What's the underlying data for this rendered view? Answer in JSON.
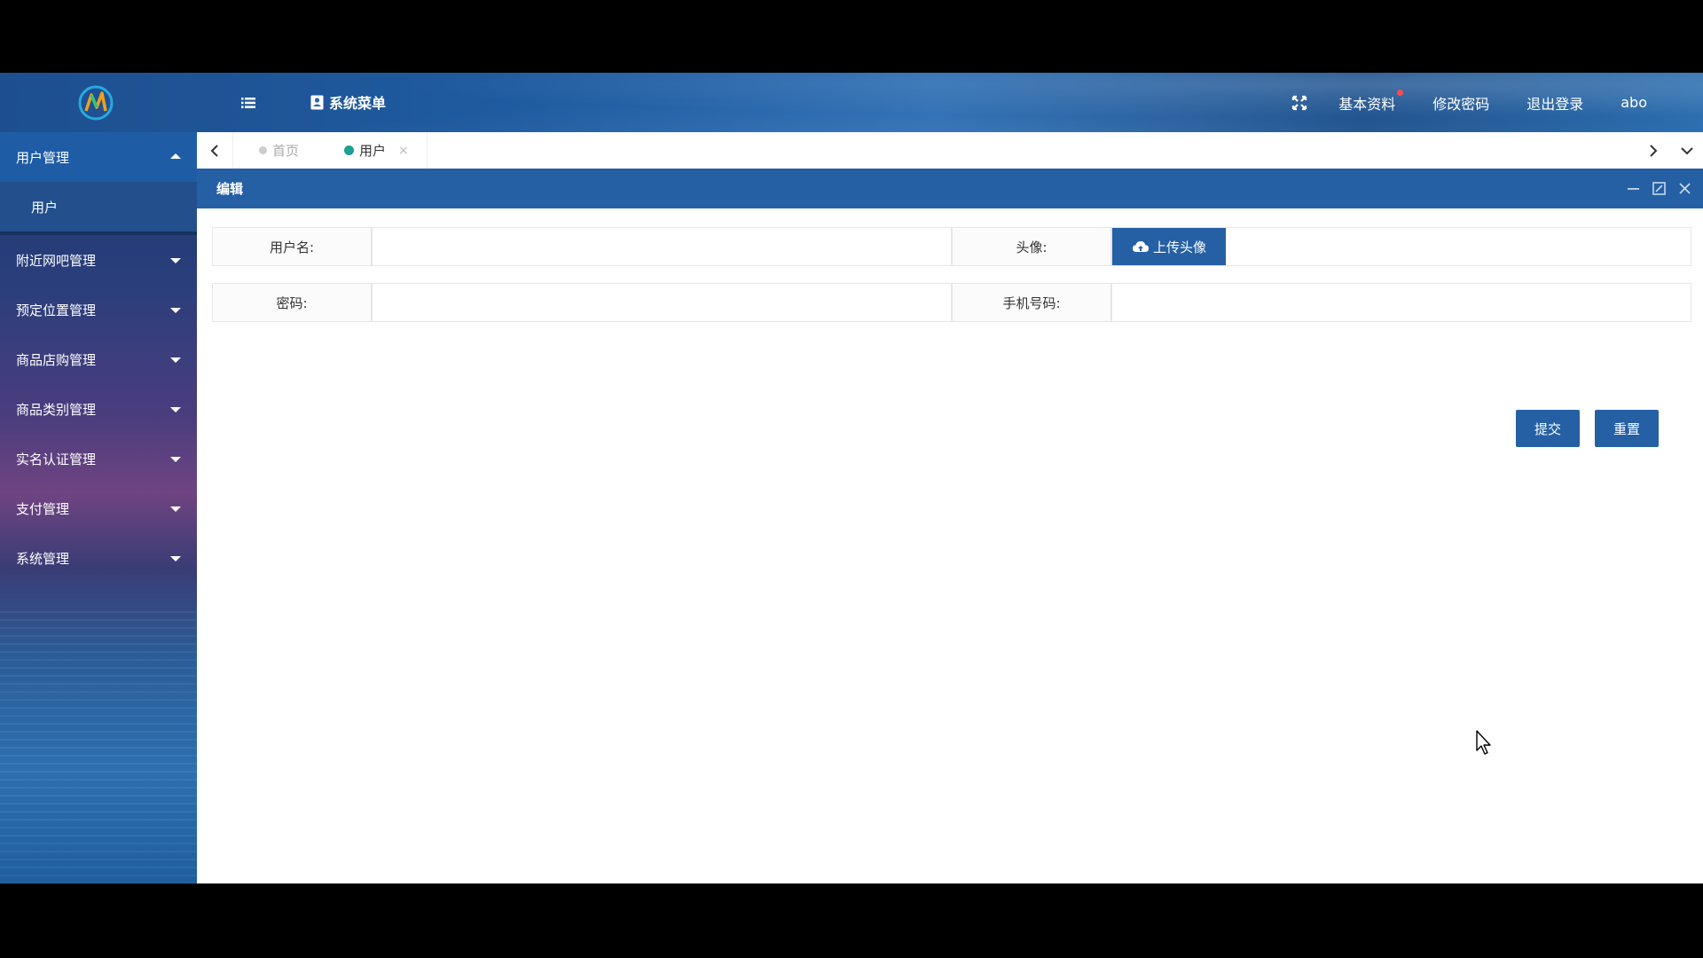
{
  "header": {
    "sys_menu_label": "系统菜单",
    "links": {
      "profile": "基本资料",
      "change_password": "修改密码",
      "logout": "退出登录"
    },
    "username": "abo"
  },
  "sidebar": {
    "active_group": "用户管理",
    "active_sub": "用户",
    "items": [
      "附近网吧管理",
      "预定位置管理",
      "商品店购管理",
      "商品类别管理",
      "实名认证管理",
      "支付管理",
      "系统管理"
    ]
  },
  "tabs": {
    "home": "首页",
    "current": "用户",
    "close_glyph": "×"
  },
  "panel": {
    "title": "编辑"
  },
  "form": {
    "username_label": "用户名:",
    "avatar_label": "头像:",
    "upload_label": "上传头像",
    "password_label": "密码:",
    "phone_label": "手机号码:",
    "username_value": "",
    "password_value": "",
    "phone_value": ""
  },
  "actions": {
    "submit": "提交",
    "reset": "重置"
  },
  "colors": {
    "primary": "#2560a5",
    "tab_active_dot": "#1aa094",
    "notice_dot": "#ff4a4a"
  },
  "icons": [
    "logo-icon",
    "menu-toggle-icon",
    "menu-icon",
    "fullscreen-icon",
    "minimize-icon",
    "maximize-icon",
    "close-icon",
    "cloud-upload-icon",
    "chevron-left-icon",
    "chevron-right-icon",
    "chevron-down-icon",
    "caret-up-icon",
    "caret-down-icon",
    "cursor-icon"
  ]
}
